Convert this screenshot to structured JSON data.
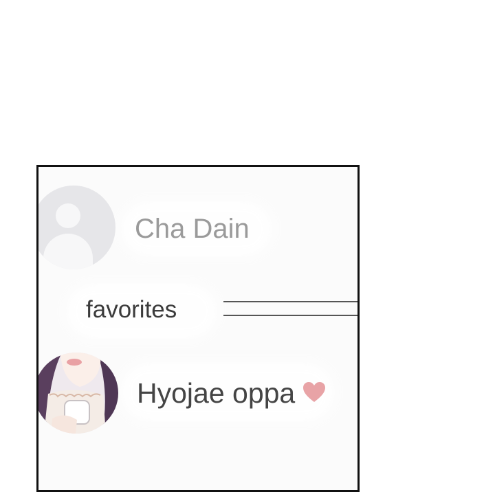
{
  "contacts": {
    "first": {
      "name": "Cha Dain",
      "avatar_icon": "default-user-icon"
    },
    "section_label": "favorites",
    "favorite": {
      "name": "Hyojae oppa",
      "suffix_icon": "heart-icon",
      "heart_color": "#e8a3a6"
    }
  }
}
